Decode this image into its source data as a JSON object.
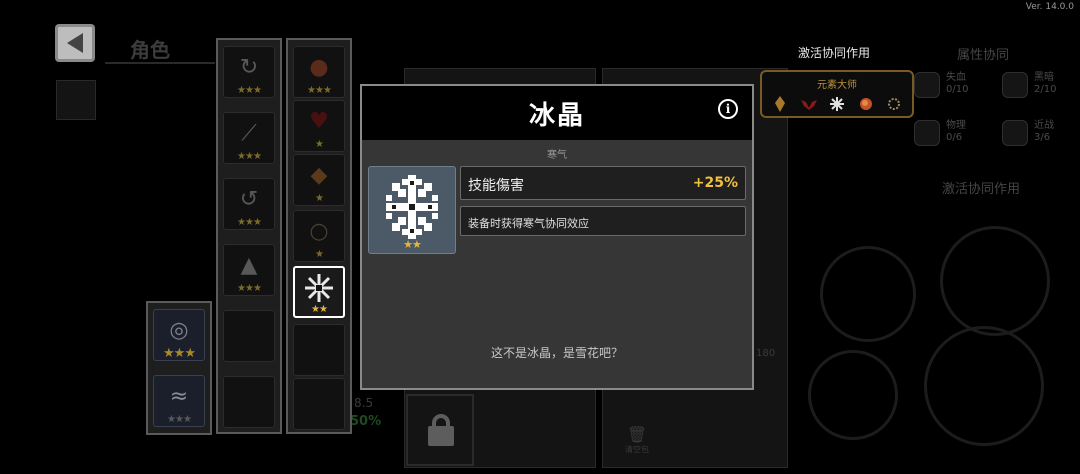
{
  "version": "Ver. 14.0.0",
  "role_tab": "角色",
  "left_columns": {
    "column1": [
      {
        "icon": "blade-swirl-icon",
        "stars": "★★★"
      },
      {
        "icon": "double-slash-icon",
        "stars": "★★★"
      },
      {
        "icon": "spin-slash-icon",
        "stars": "★★★"
      },
      {
        "icon": "spike-icon",
        "stars": "★★★"
      },
      {
        "icon": "empty",
        "stars": ""
      },
      {
        "icon": "empty",
        "stars": ""
      }
    ],
    "column2": [
      {
        "icon": "fire-orb-icon",
        "stars": "★★★"
      },
      {
        "icon": "demon-wings-icon",
        "stars": "★"
      },
      {
        "icon": "fire-crystal-icon",
        "stars": "★"
      },
      {
        "icon": "bead-necklace-icon",
        "stars": "★"
      },
      {
        "icon": "snowflake-icon",
        "stars": "★★"
      },
      {
        "icon": "empty",
        "stars": ""
      },
      {
        "icon": "empty",
        "stars": ""
      }
    ],
    "column0": [
      {
        "icon": "vortex-icon",
        "stars": "★★★"
      },
      {
        "icon": "wind-icon",
        "stars": "★★★"
      }
    ]
  },
  "synergy": {
    "heading": "激活协同作用",
    "name": "元素大师",
    "icons": [
      "fire-crystal-icon",
      "demon-wings-icon",
      "snowflake-icon",
      "fire-orb-icon",
      "bead-necklace-icon"
    ]
  },
  "attributes": {
    "title": "属性协同",
    "items": [
      {
        "label": "失血",
        "value": "0/10"
      },
      {
        "label": "黑暗",
        "value": "2/10"
      },
      {
        "label": "物理",
        "value": "0/6"
      },
      {
        "label": "近战",
        "value": "3/6"
      }
    ],
    "active_title": "激活协同作用"
  },
  "background": {
    "value_small": "8.5",
    "value_green": "50%",
    "value_180": "180",
    "trash_label": "清空包"
  },
  "modal": {
    "title": "冰晶",
    "subtitle": "寒气",
    "item_stars": "★★",
    "stat_label": "技能傷害",
    "stat_value": "+25%",
    "effect": "装备时获得寒气协同效应",
    "flavor": "这不是冰晶，是雪花吧？"
  },
  "colors": {
    "gold": "#e7b43c",
    "synergy_border": "#7a5a23",
    "modal_bg": "#363636"
  }
}
